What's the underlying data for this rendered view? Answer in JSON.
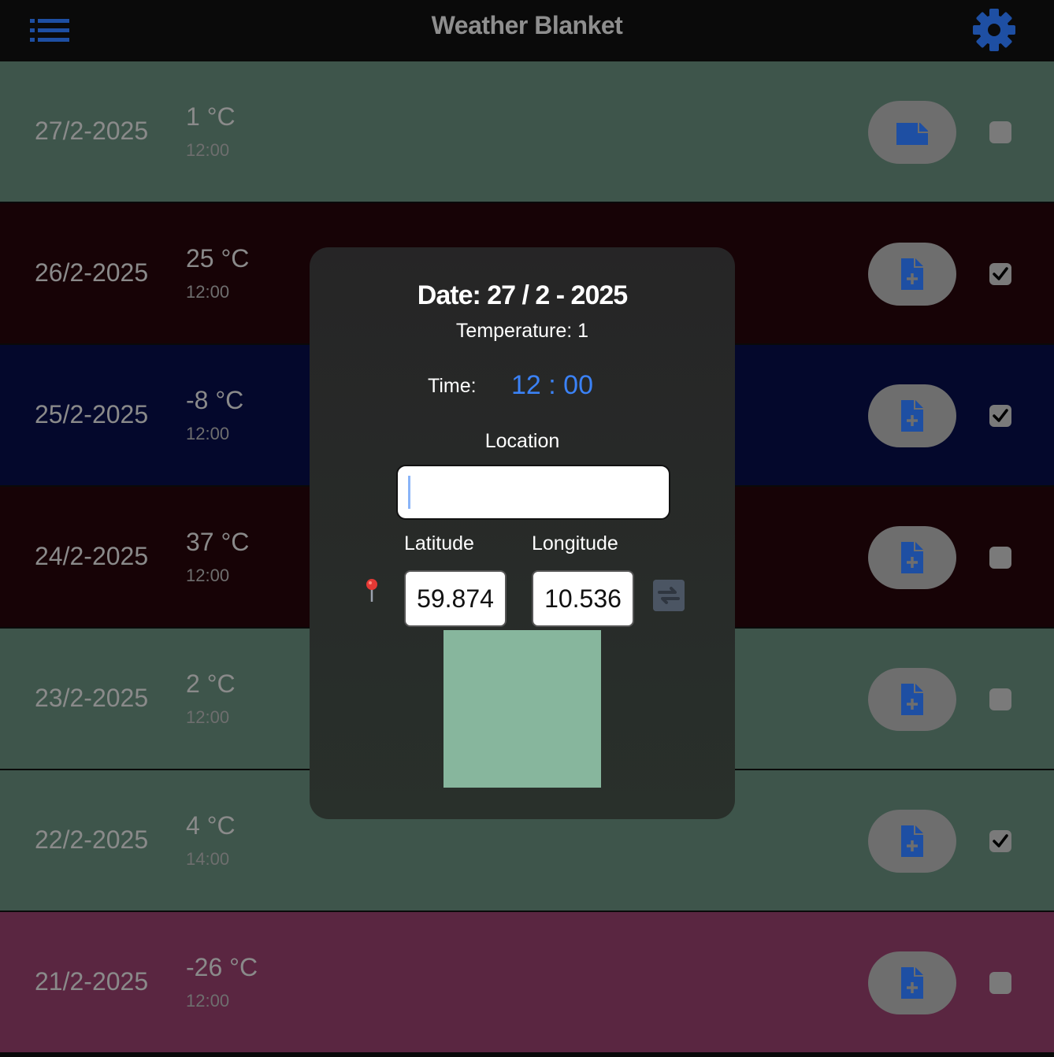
{
  "header": {
    "title": "Weather Blanket",
    "menu_icon": "list-icon",
    "settings_icon": "gear-icon",
    "accent_color": "#1e4fa3"
  },
  "rows": [
    {
      "date": "27/2-2025",
      "temp": "1 °C",
      "time": "12:00",
      "bg": "#3e554b",
      "icon": "note-filled-icon",
      "checked": false
    },
    {
      "date": "26/2-2025",
      "temp": "25 °C",
      "time": "12:00",
      "bg": "#170306",
      "icon": "note-add-icon",
      "checked": true
    },
    {
      "date": "25/2-2025",
      "temp": "-8 °C",
      "time": "12:00",
      "bg": "#04082c",
      "icon": "note-add-icon",
      "checked": true
    },
    {
      "date": "24/2-2025",
      "temp": "37 °C",
      "time": "12:00",
      "bg": "#170306",
      "icon": "note-add-icon",
      "checked": false
    },
    {
      "date": "23/2-2025",
      "temp": "2 °C",
      "time": "12:00",
      "bg": "#3e554b",
      "icon": "note-add-icon",
      "checked": false
    },
    {
      "date": "22/2-2025",
      "temp": "4 °C",
      "time": "14:00",
      "bg": "#3e554b",
      "icon": "note-add-icon",
      "checked": true
    },
    {
      "date": "21/2-2025",
      "temp": "-26 °C",
      "time": "12:00",
      "bg": "#5a2641",
      "icon": "note-add-icon",
      "checked": false
    }
  ],
  "dialog": {
    "date": "Date: 27 / 2 - 2025",
    "temperature": "Temperature: 1",
    "time_label": "Time:",
    "time_value": "12 : 00",
    "location_label": "Location",
    "location_value": "",
    "latitude_label": "Latitude",
    "longitude_label": "Longitude",
    "latitude": "59.874",
    "longitude": "10.536",
    "swatch_color": "#87b69d"
  }
}
